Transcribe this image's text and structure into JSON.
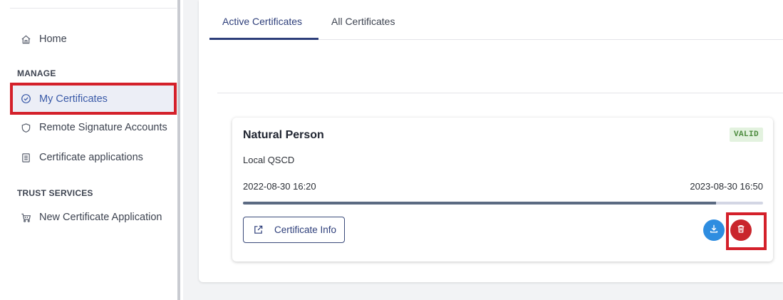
{
  "sidebar": {
    "home_label": "Home",
    "manage_section": "MANAGE",
    "my_certificates_label": "My Certificates",
    "remote_signature_label": "Remote Signature Accounts",
    "certificate_applications_label": "Certificate applications",
    "trust_services_section": "TRUST SERVICES",
    "new_application_label": "New Certificate Application"
  },
  "tabs": {
    "active": "Active Certificates",
    "all": "All Certificates"
  },
  "certificate": {
    "title": "Natural Person",
    "status": "VALID",
    "subtitle": "Local QSCD",
    "valid_from": "2022-08-30 16:20",
    "valid_to": "2023-08-30 16:50",
    "validity_progress": 0.91,
    "info_button_label": "Certificate Info"
  },
  "colors": {
    "accent": "#2d3e7a",
    "valid": "#4b8a3c",
    "download": "#2e8de0",
    "delete": "#c9252c",
    "highlight": "#d4202a"
  },
  "icons": {
    "home": "home-icon",
    "my_certificates": "check-circle-icon",
    "remote_signature": "shield-icon",
    "certificate_applications": "document-list-icon",
    "new_application": "cart-icon",
    "info": "external-link-icon",
    "download": "download-icon",
    "delete": "trash-icon"
  }
}
